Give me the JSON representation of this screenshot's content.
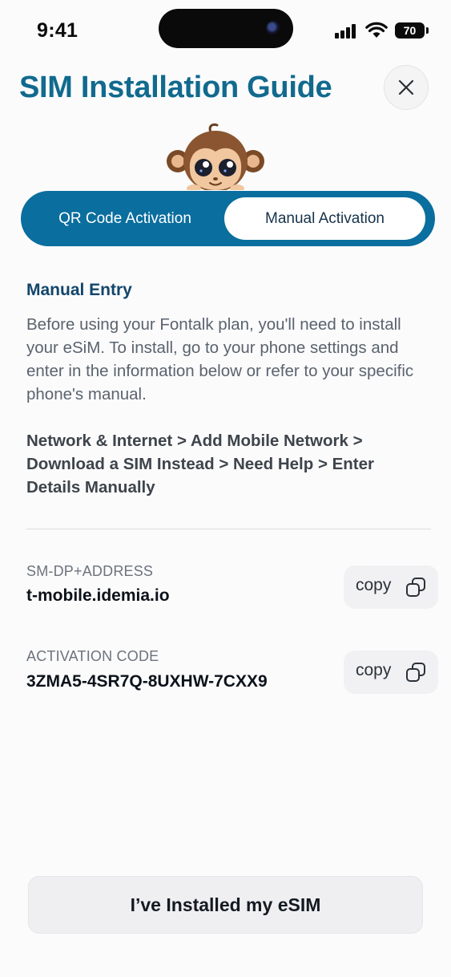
{
  "status_bar": {
    "time": "9:41",
    "battery": "70"
  },
  "header": {
    "title": "SIM Installation Guide",
    "close_icon": "close-icon"
  },
  "tabs": [
    {
      "label": "QR Code Activation",
      "selected": false
    },
    {
      "label": "Manual Activation",
      "selected": true
    }
  ],
  "manual": {
    "heading": "Manual Entry",
    "intro": "Before using your Fontalk plan, you'll need to install your eSiM. To install, go to your phone settings and enter in the information below or refer to your specific phone's manual.",
    "path": "Network & Internet > Add Mobile Network > Download a SIM Instead > Need Help > Enter Details Manually"
  },
  "fields": [
    {
      "label": "SM-DP+ADDRESS",
      "value": "t-mobile.idemia.io",
      "copy_label": "copy"
    },
    {
      "label": "ACTIVATION CODE",
      "value": "3ZMA5-4SR7Q-8UXHW-7CXX9",
      "copy_label": "copy"
    }
  ],
  "footer": {
    "button_label": "I’ve Installed my eSIM"
  },
  "colors": {
    "brand": "#116a8e",
    "segment_bg": "#0a6e9e"
  }
}
